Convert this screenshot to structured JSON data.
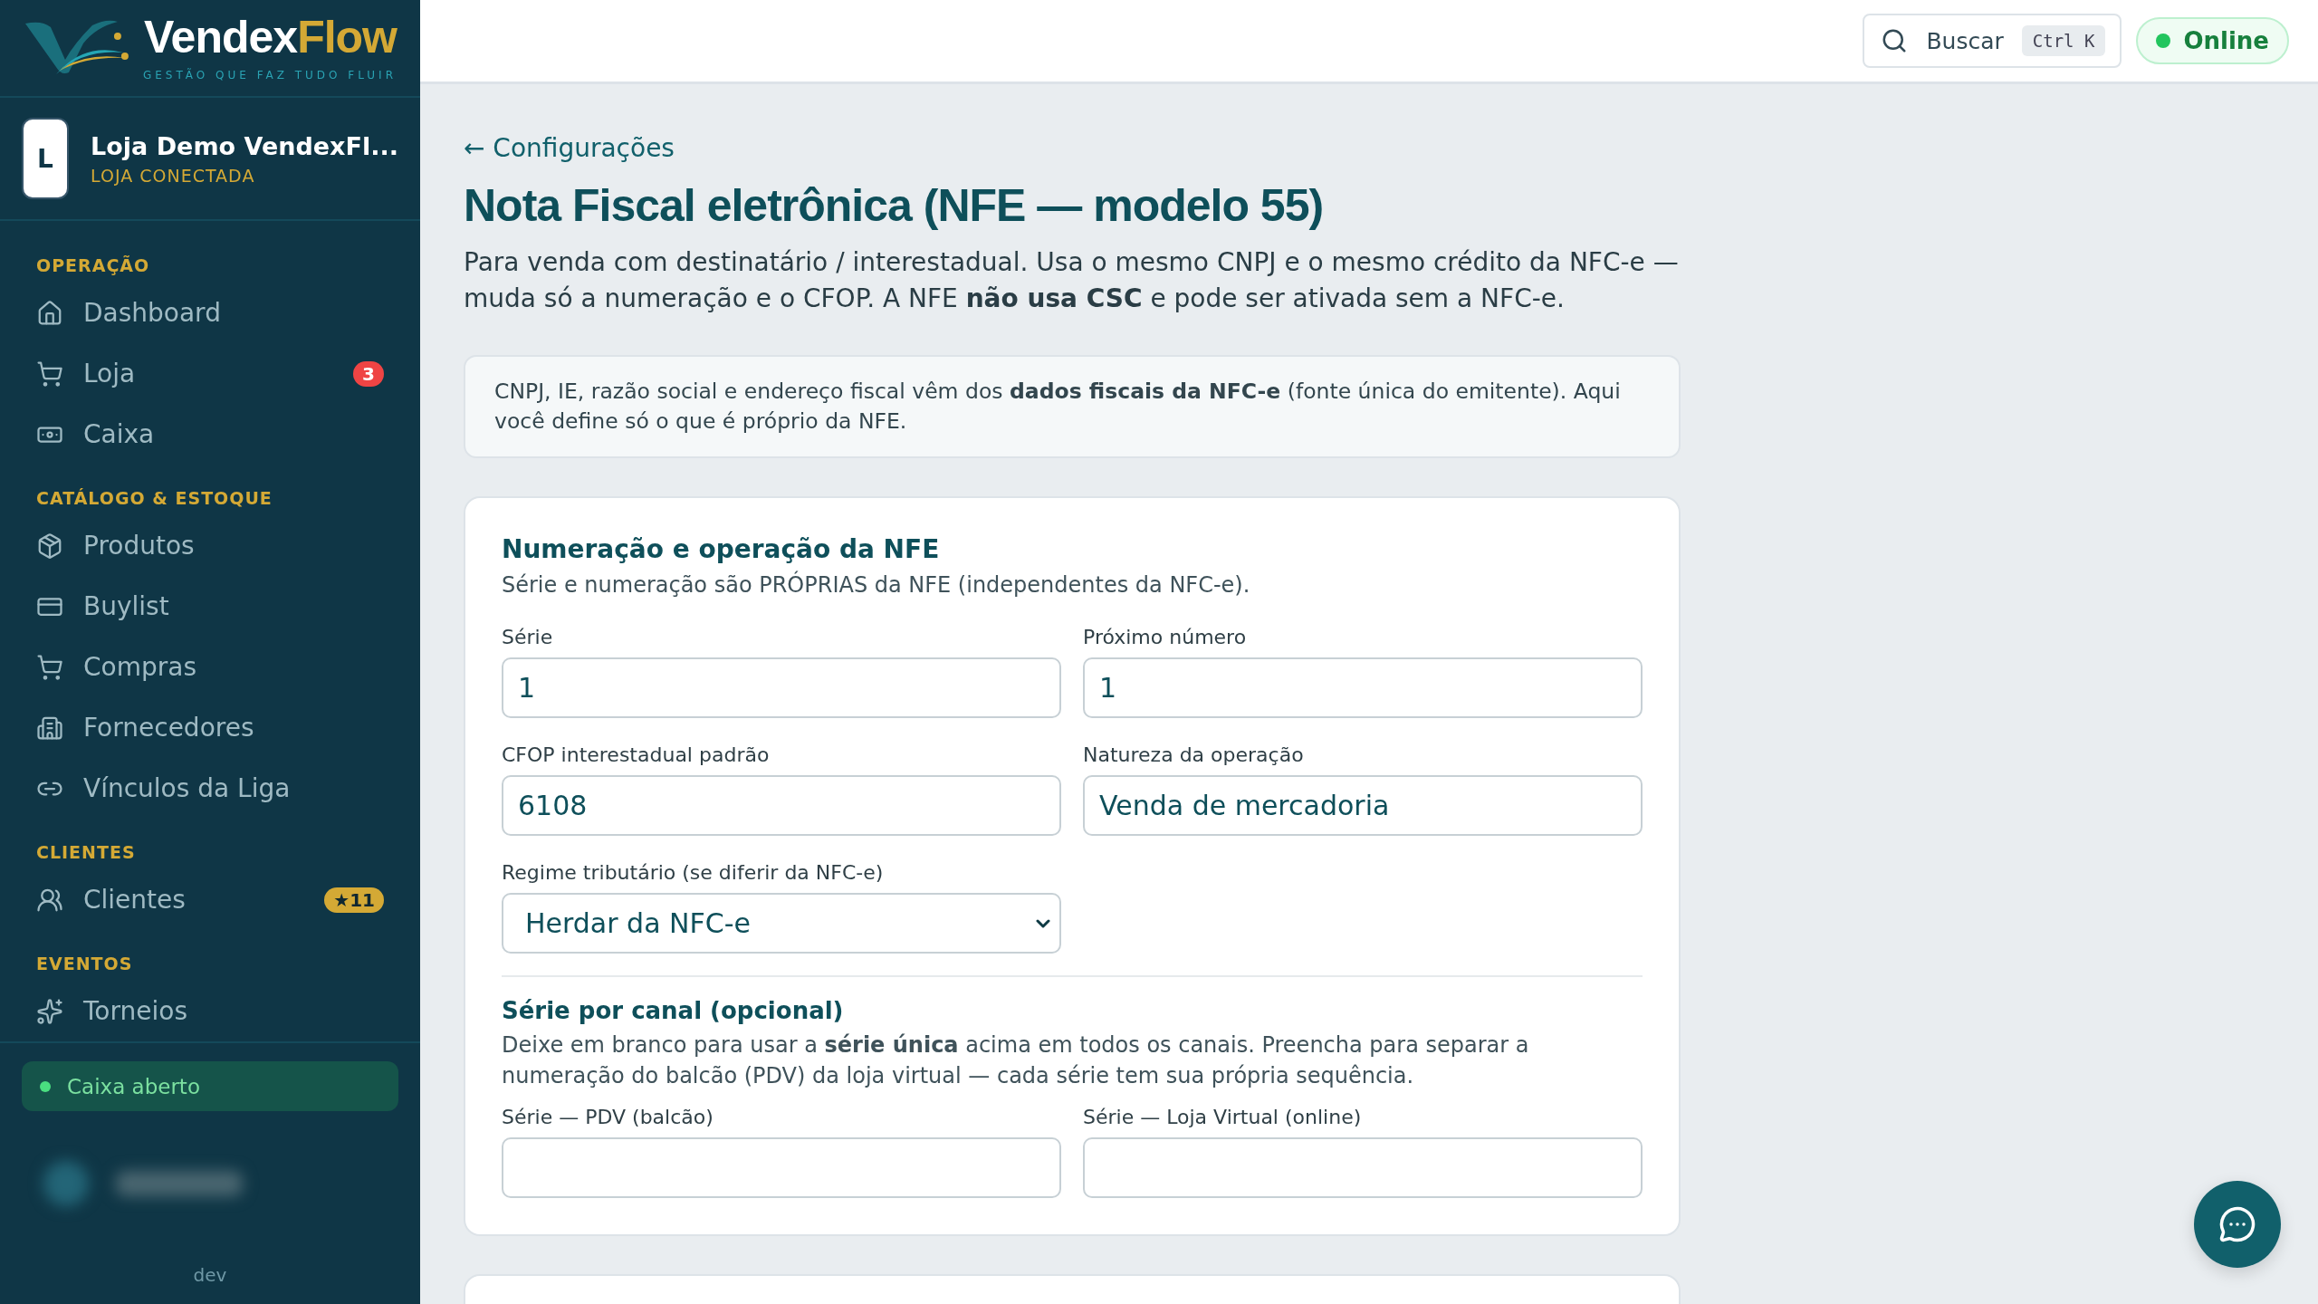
{
  "brand": {
    "name_part_1": "Vendex",
    "name_part_2": "Flow",
    "tagline": "GESTÃO QUE FAZ TUDO FLUIR"
  },
  "store": {
    "initial": "L",
    "name": "Loja Demo VendexFl...",
    "status": "LOJA CONECTADA"
  },
  "sidebar": {
    "sections": [
      {
        "title": "OPERAÇÃO",
        "items": [
          {
            "label": "Dashboard"
          },
          {
            "label": "Loja",
            "badge": {
              "text": "3",
              "kind": "count"
            }
          },
          {
            "label": "Caixa"
          }
        ]
      },
      {
        "title": "CATÁLOGO & ESTOQUE",
        "items": [
          {
            "label": "Produtos"
          },
          {
            "label": "Buylist"
          },
          {
            "label": "Compras"
          },
          {
            "label": "Fornecedores"
          },
          {
            "label": "Vínculos da Liga"
          }
        ]
      },
      {
        "title": "CLIENTES",
        "items": [
          {
            "label": "Clientes",
            "badge": {
              "text": "★11",
              "kind": "star"
            }
          }
        ]
      },
      {
        "title": "EVENTOS",
        "items": [
          {
            "label": "Torneios"
          }
        ]
      }
    ],
    "register_status": {
      "label": "Caixa aberto",
      "open": true
    },
    "footer": "dev"
  },
  "topbar": {
    "search": {
      "label": "Buscar",
      "shortcut": "Ctrl K"
    },
    "connection": {
      "label": "Online",
      "online": true
    }
  },
  "page": {
    "back_link": "← Configurações",
    "title": "Nota Fiscal eletrônica (NFE — modelo 55)",
    "description": "Para venda com destinatário / interestadual. Usa o mesmo CNPJ e o mesmo crédito da NFC-e — muda só a numeração e o CFOP. A NFE **não usa CSC** e pode ser ativada sem a NFC-e.",
    "info": "CNPJ, IE, razão social e endereço fiscal vêm dos **dados fiscais da NFC-e** (fonte única do emitente). Aqui você define só o que é próprio da NFE."
  },
  "card": {
    "title": "Numeração e operação da NFE",
    "subtitle": "Série e numeração são PRÓPRIAS da NFE (independentes da NFC-e).",
    "fields": [
      {
        "kind": "input",
        "label": "Série",
        "value": "1"
      },
      {
        "kind": "input",
        "label": "Próximo número",
        "value": "1"
      },
      {
        "kind": "input",
        "label": "CFOP interestadual padrão",
        "value": "6108"
      },
      {
        "kind": "input",
        "label": "Natureza da operação",
        "value": "Venda de mercadoria"
      },
      {
        "kind": "select",
        "label": "Regime tributário (se diferir da NFC-e)",
        "value": "Herdar da NFC-e"
      }
    ],
    "channel_section": {
      "title": "Série por canal (opcional)",
      "description": "Deixe em branco para usar a **série única** acima em todos os canais. Preencha para separar a numeração do balcão (PDV) da loja virtual — cada série tem sua própria sequência.",
      "fields": [
        {
          "kind": "input",
          "label": "Série — PDV (balcão)"
        },
        {
          "kind": "input",
          "label": "Série — Loja Virtual (online)"
        }
      ]
    }
  }
}
